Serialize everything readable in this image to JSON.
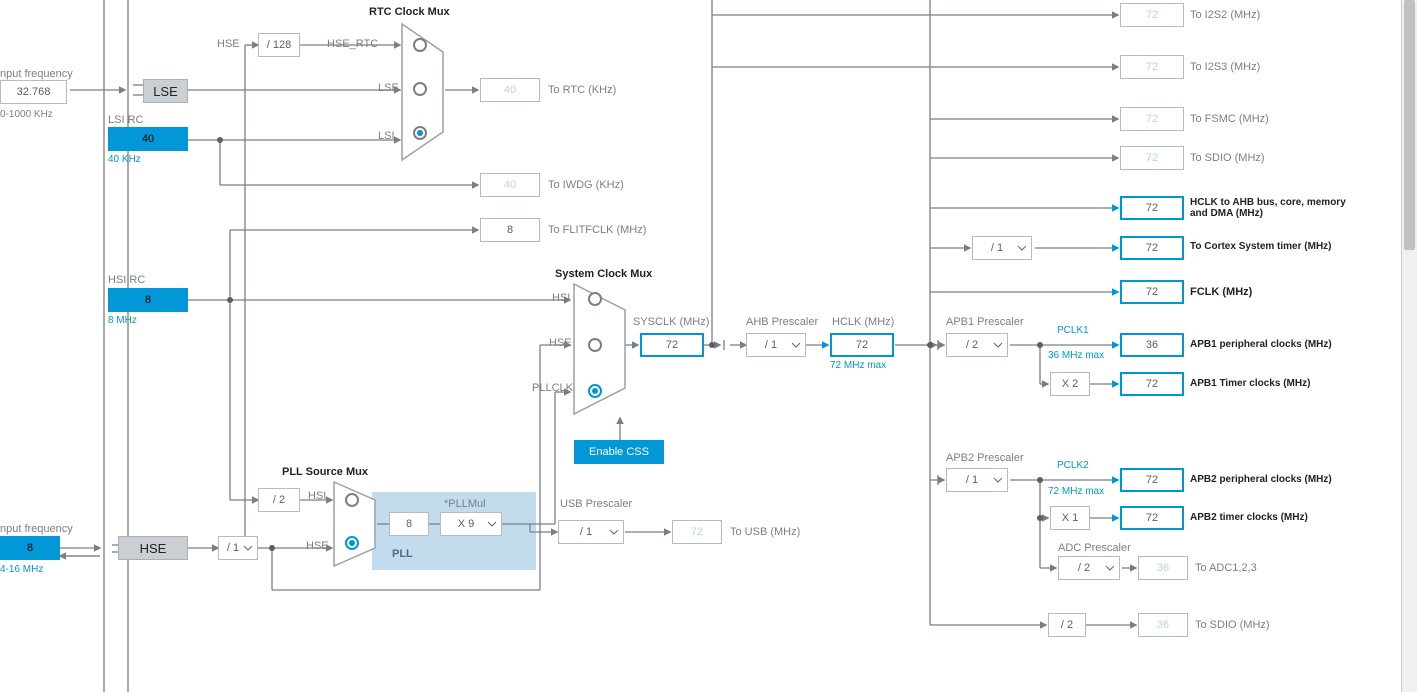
{
  "lse": {
    "freq": "32.768",
    "label": "LSE",
    "input_label": "nput frequency",
    "range": "0-1000 KHz"
  },
  "lsi": {
    "label": "LSI RC",
    "value": "40",
    "unit": "40 KHz"
  },
  "hse": {
    "label_left": "HSE",
    "input_label": "nput frequency",
    "value": "8",
    "range": "4-16 MHz",
    "div128": "/ 128"
  },
  "hsi": {
    "label": "HSI RC",
    "value": "8",
    "unit": "8 MHz"
  },
  "rtc_mux": {
    "title": "RTC Clock Mux",
    "in": [
      "HSE",
      "LSE",
      "LSI"
    ],
    "line": "HSE_RTC"
  },
  "to_rtc": {
    "val": "40",
    "label": "To RTC (KHz)"
  },
  "to_iwdg": {
    "val": "40",
    "label": "To IWDG (KHz)"
  },
  "to_flitf": {
    "val": "8",
    "label": "To FLITFCLK (MHz)"
  },
  "pll": {
    "title": "PLL Source Mux",
    "hsi_div": "/ 2",
    "hse_pre": "/ 1",
    "val": "8",
    "mul": "X 9",
    "mul_label": "*PLLMul",
    "box": "PLL",
    "in": [
      "HSI",
      "HSE"
    ]
  },
  "usb": {
    "title": "USB Prescaler",
    "div": "/ 1",
    "val": "72",
    "label": "To USB (MHz)"
  },
  "sys": {
    "title": "System Clock Mux",
    "in": [
      "HSI",
      "HSE",
      "PLLCLK"
    ],
    "css": "Enable CSS"
  },
  "sysclk": {
    "val": "72",
    "label": "SYSCLK (MHz)"
  },
  "ahb": {
    "title": "AHB Prescaler",
    "div": "/ 1"
  },
  "hclk": {
    "val": "72",
    "label": "HCLK (MHz)",
    "max": "72 MHz max"
  },
  "cortex": {
    "div": "/ 1",
    "val": "72",
    "label": "To Cortex System timer (MHz)"
  },
  "apb1": {
    "title": "APB1 Prescaler",
    "div": "/ 2",
    "pclk": "PCLK1",
    "max": "36 MHz max",
    "pval": "36",
    "plabel": "APB1 peripheral clocks (MHz)",
    "tmul": "X 2",
    "tval": "72",
    "tlabel": "APB1 Timer clocks (MHz)"
  },
  "apb2": {
    "title": "APB2 Prescaler",
    "div": "/ 1",
    "pclk": "PCLK2",
    "max": "72 MHz max",
    "pval": "72",
    "plabel": "APB2 peripheral clocks (MHz)",
    "tmul": "X 1",
    "tval": "72",
    "tlabel": "APB2 timer clocks (MHz)"
  },
  "adc": {
    "title": "ADC Prescaler",
    "div": "/ 2",
    "val": "36",
    "label": "To ADC1,2,3"
  },
  "sdioclk": {
    "div": "/ 2",
    "val": "36",
    "label": "To SDIO (MHz)"
  },
  "periph": {
    "i2s2": {
      "val": "72",
      "label": "To I2S2 (MHz)"
    },
    "i2s3": {
      "val": "72",
      "label": "To I2S3 (MHz)"
    },
    "fsmc": {
      "val": "72",
      "label": "To FSMC (MHz)"
    },
    "sdio_top": {
      "val": "72",
      "label": "To SDIO (MHz)"
    },
    "ahbbus": {
      "val": "72",
      "label": "HCLK to AHB bus, core, memory and DMA (MHz)"
    },
    "fclk": {
      "val": "72",
      "label": "FCLK (MHz)"
    }
  }
}
